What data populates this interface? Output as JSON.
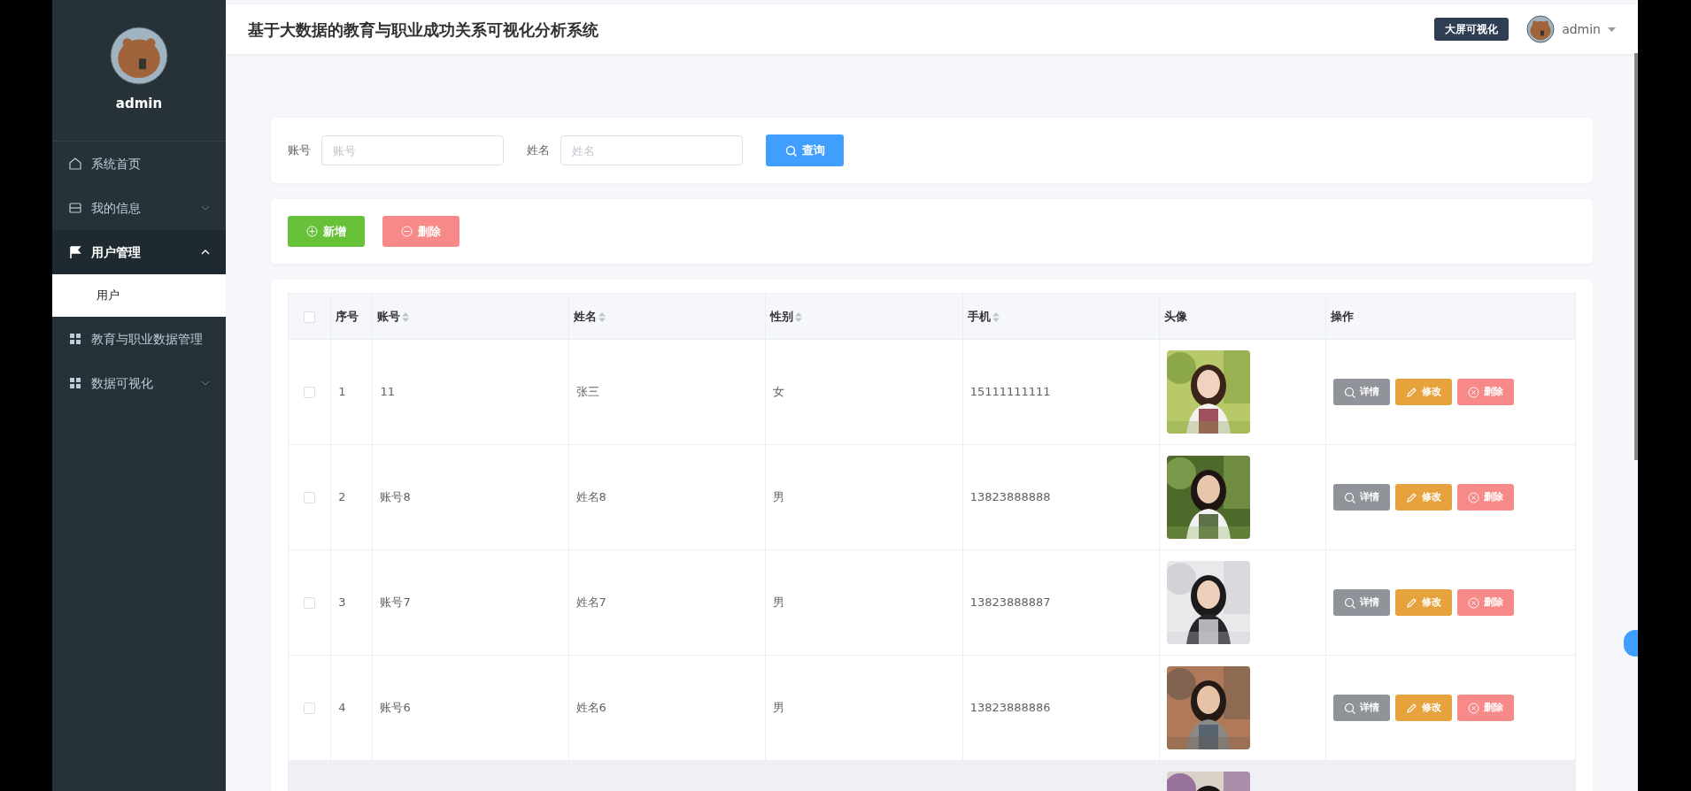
{
  "sidebar": {
    "user": {
      "name": "admin"
    },
    "items": [
      {
        "label": "系统首页",
        "kind": "link",
        "selected": false
      },
      {
        "label": "我的信息",
        "kind": "submenu",
        "expanded": false,
        "selected": false
      },
      {
        "label": "用户管理",
        "kind": "submenu",
        "expanded": true,
        "selected": true,
        "children": [
          {
            "label": "用户",
            "selected": true
          }
        ]
      },
      {
        "label": "教育与职业数据管理",
        "kind": "link",
        "selected": false
      },
      {
        "label": "数据可视化",
        "kind": "submenu",
        "expanded": false,
        "selected": false
      }
    ]
  },
  "header": {
    "title": "基于大数据的教育与职业成功关系可视化分析系统",
    "big_screen_button": "大屏可视化",
    "user": "admin"
  },
  "search": {
    "fields": [
      {
        "label": "账号",
        "placeholder": "账号"
      },
      {
        "label": "姓名",
        "placeholder": "姓名"
      }
    ],
    "button": "查询"
  },
  "actions": [
    {
      "label": "新增",
      "kind": "add"
    },
    {
      "label": "删除",
      "kind": "delete"
    }
  ],
  "table": {
    "select_all": {
      "checked": false
    },
    "columns": [
      {
        "label": "序号",
        "sortable": false
      },
      {
        "label": "账号",
        "sortable": true
      },
      {
        "label": "姓名",
        "sortable": true
      },
      {
        "label": "性别",
        "sortable": true
      },
      {
        "label": "手机",
        "sortable": true
      },
      {
        "label": "头像",
        "sortable": false
      },
      {
        "label": "操作",
        "sortable": false
      }
    ],
    "rows": [
      {
        "checked": false,
        "highlighted": false,
        "cells": [
          "1",
          "11",
          "张三",
          "女",
          "15111111111"
        ],
        "actions": [
          {
            "label": "详情",
            "kind": "detail"
          },
          {
            "label": "修改",
            "kind": "edit"
          },
          {
            "label": "删除",
            "kind": "delete"
          }
        ]
      },
      {
        "checked": false,
        "highlighted": false,
        "cells": [
          "2",
          "账号8",
          "姓名8",
          "男",
          "13823888888"
        ],
        "actions": [
          {
            "label": "详情",
            "kind": "detail"
          },
          {
            "label": "修改",
            "kind": "edit"
          },
          {
            "label": "删除",
            "kind": "delete"
          }
        ]
      },
      {
        "checked": false,
        "highlighted": false,
        "cells": [
          "3",
          "账号7",
          "姓名7",
          "男",
          "13823888887"
        ],
        "actions": [
          {
            "label": "详情",
            "kind": "detail"
          },
          {
            "label": "修改",
            "kind": "edit"
          },
          {
            "label": "删除",
            "kind": "delete"
          }
        ]
      },
      {
        "checked": false,
        "highlighted": false,
        "cells": [
          "4",
          "账号6",
          "姓名6",
          "男",
          "13823888886"
        ],
        "actions": [
          {
            "label": "详情",
            "kind": "detail"
          },
          {
            "label": "修改",
            "kind": "edit"
          },
          {
            "label": "删除",
            "kind": "delete"
          }
        ]
      },
      {
        "highlighted": true
      }
    ]
  }
}
